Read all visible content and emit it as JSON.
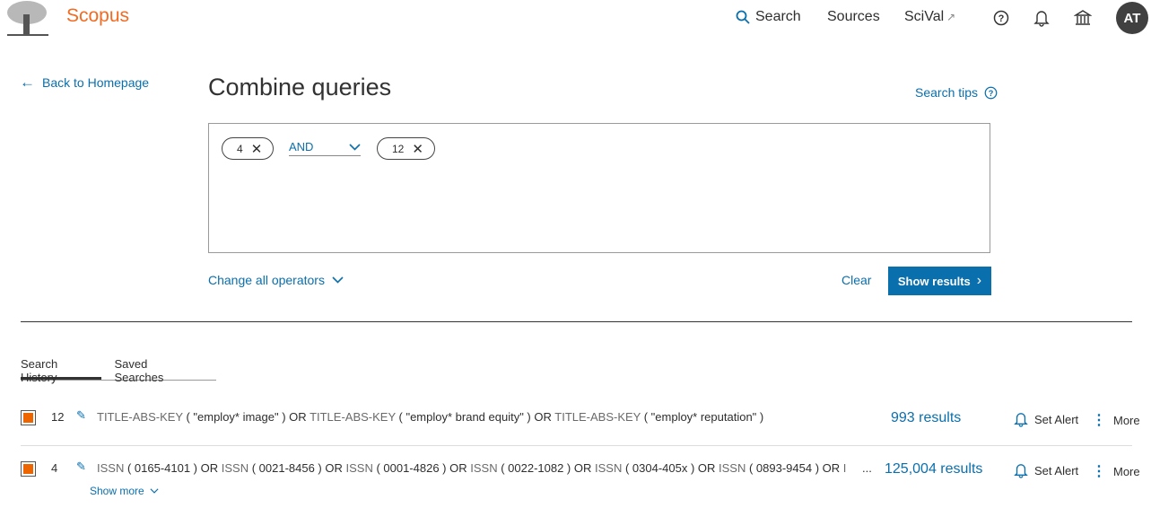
{
  "header": {
    "brand": "Scopus",
    "logo_text": "Elsevier",
    "nav": [
      {
        "label": "Search",
        "icon": "search-icon"
      },
      {
        "label": "Sources"
      },
      {
        "label": "SciVal",
        "icon": "external-link-icon"
      }
    ],
    "avatar": "AT",
    "icons": [
      "help-icon",
      "bell-icon",
      "institution-icon"
    ]
  },
  "back_link": "Back to Homepage",
  "title": "Combine queries",
  "search_tips": "Search tips",
  "query": {
    "chips": [
      "4",
      "12"
    ],
    "operator": "AND"
  },
  "change_operators": "Change all operators",
  "clear": "Clear",
  "show_results": "Show results",
  "tabs": [
    {
      "label": "Search History",
      "active": true
    },
    {
      "label": "Saved Searches",
      "active": false
    }
  ],
  "history": [
    {
      "id": "12",
      "checked": true,
      "query": [
        [
          "k",
          "TITLE-ABS-KEY"
        ],
        [
          "v",
          " ( \"employ* image\" ) "
        ],
        [
          "o",
          "OR "
        ],
        [
          "k",
          "TITLE-ABS-KEY"
        ],
        [
          "v",
          " ( \"employ* brand equity\" ) "
        ],
        [
          "o",
          "OR "
        ],
        [
          "k",
          "TITLE-ABS-KEY"
        ],
        [
          "v",
          " ( \"employ* reputation\" )"
        ]
      ],
      "results": "993 results",
      "set_alert": "Set Alert",
      "more": "More"
    },
    {
      "id": "4",
      "checked": true,
      "query": [
        [
          "k",
          "ISSN"
        ],
        [
          "v",
          " ( 0165-4101 ) "
        ],
        [
          "o",
          "OR "
        ],
        [
          "k",
          "ISSN"
        ],
        [
          "v",
          " ( 0021-8456 ) "
        ],
        [
          "o",
          "OR "
        ],
        [
          "k",
          "ISSN"
        ],
        [
          "v",
          " ( 0001-4826 ) "
        ],
        [
          "o",
          "OR "
        ],
        [
          "k",
          "ISSN"
        ],
        [
          "v",
          " ( 0022-1082 ) "
        ],
        [
          "o",
          "OR "
        ],
        [
          "k",
          "ISSN"
        ],
        [
          "v",
          " ( 0304-405x ) "
        ],
        [
          "o",
          "OR "
        ],
        [
          "k",
          "ISSN"
        ],
        [
          "v",
          " ( 0893-9454 ) "
        ],
        [
          "o",
          "OR "
        ],
        [
          "k",
          "ISSN"
        ],
        [
          "v",
          " ("
        ]
      ],
      "ellipsis": "...",
      "results": "125,004 results",
      "set_alert": "Set Alert",
      "more": "More",
      "show_more": "Show more"
    }
  ],
  "colors": {
    "brand": "#f26b21",
    "accent": "#0a6fad",
    "checkbox": "#ec6500"
  }
}
